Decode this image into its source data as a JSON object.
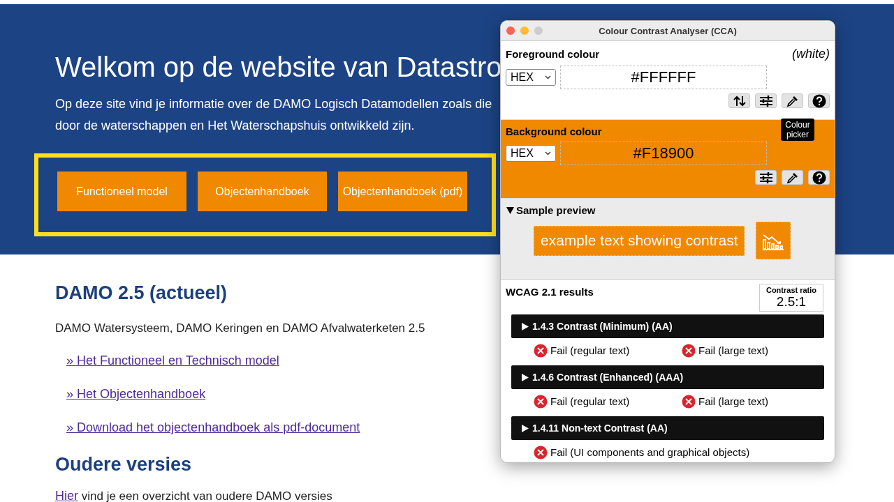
{
  "hero": {
    "title": "Welkom op de website van Datastro",
    "intro": "Op deze site vind je informatie over de DAMO Logisch Datamodellen zoals die door de waterschappen en Het Waterschapshuis ontwikkeld zijn.",
    "highlighted": true,
    "buttons": [
      "Functioneel model",
      "Objectenhandboek",
      "Objectenhandboek (pdf)"
    ]
  },
  "content": {
    "heading": "DAMO 2.5 (actueel)",
    "text": "DAMO Watersysteem, DAMO Keringen en DAMO Afvalwaterketen 2.5",
    "links": [
      "» Het Functioneel en Technisch model",
      "» Het Objectenhandboek",
      "» Download het objectenhandboek als pdf-document"
    ],
    "heading_2": "Oudere versies",
    "text_2_link": "Hier",
    "text_2": " vind je een overzicht van oudere DAMO versies"
  },
  "window": {
    "title": "Colour Contrast Analyser (CCA)",
    "sections": [
      {
        "label": "Foreground colour",
        "name": "(white)",
        "format": "HEX",
        "value": "#FFFFFF",
        "color": "#ffffff",
        "tools": [
          {
            "kind": "swap"
          },
          {
            "kind": "sliders"
          },
          {
            "kind": "picker"
          },
          {
            "kind": "help"
          }
        ]
      },
      {
        "label": "Background colour",
        "format": "HEX",
        "value": "#F18900",
        "color": "#f18900",
        "tools": [
          {
            "kind": "sliders"
          },
          {
            "kind": "picker"
          },
          {
            "kind": "help"
          }
        ]
      }
    ],
    "tooltip": "Colour picker",
    "preview": {
      "label": "Sample preview",
      "expanded": true,
      "text": "example text showing contrast"
    },
    "results": {
      "title": "WCAG 2.1 results",
      "ratio_label": "Contrast ratio",
      "ratio": "2.5:1",
      "criteria": [
        {
          "title": "1.4.3 Contrast (Minimum) (AA)",
          "expanded": false,
          "checks": [
            {
              "label": "Fail (regular text)",
              "passed": false
            },
            {
              "label": "Fail (large text)",
              "passed": false
            }
          ]
        },
        {
          "title": "1.4.6 Contrast (Enhanced) (AAA)",
          "expanded": false,
          "checks": [
            {
              "label": "Fail (regular text)",
              "passed": false
            },
            {
              "label": "Fail (large text)",
              "passed": false
            }
          ]
        },
        {
          "title": "1.4.11 Non-text Contrast (AA)",
          "expanded": false,
          "checks": [
            {
              "label": "Fail (UI components and graphical objects)",
              "passed": false
            }
          ]
        }
      ]
    }
  }
}
